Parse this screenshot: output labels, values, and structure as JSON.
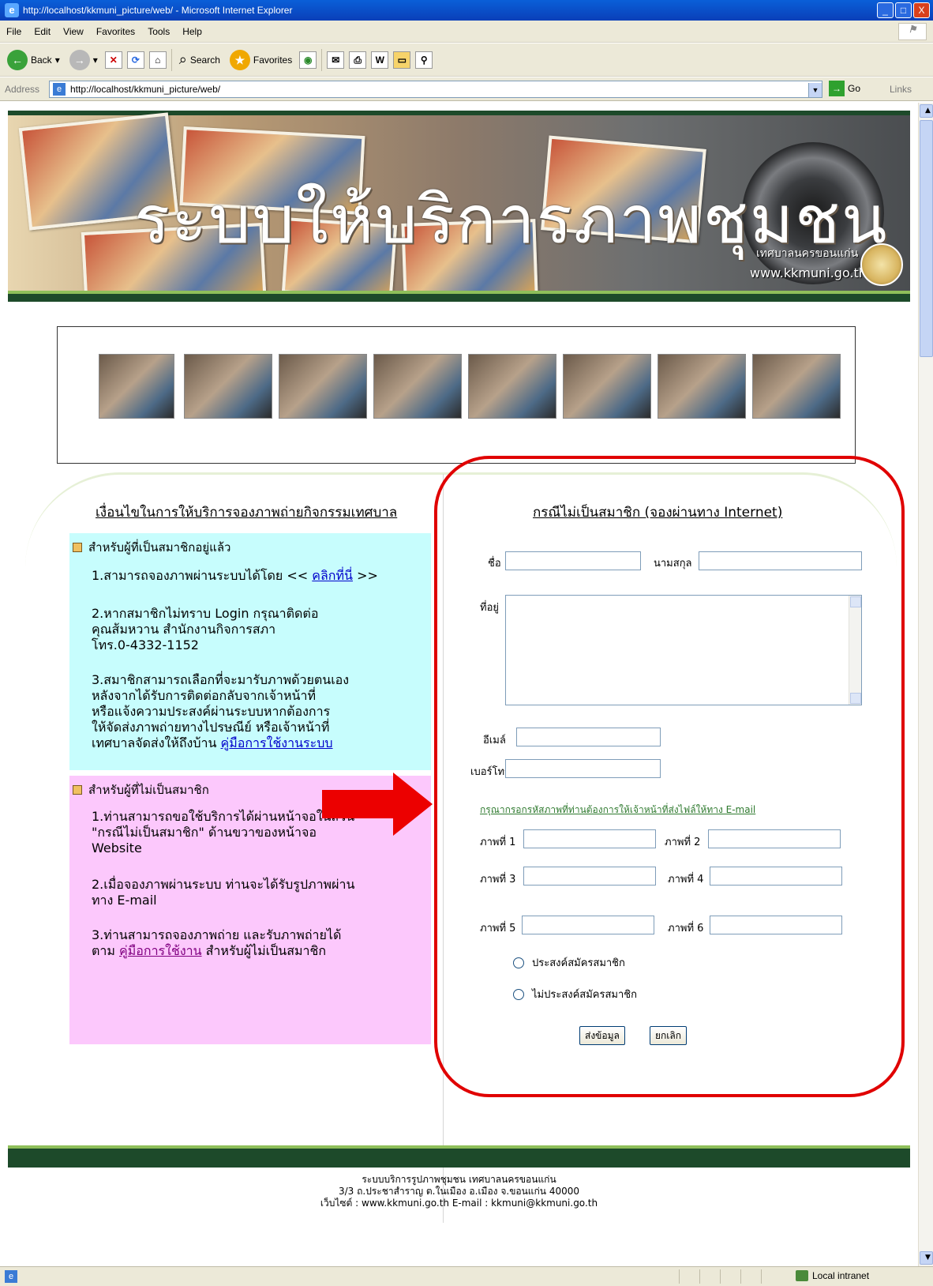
{
  "window": {
    "title": "http://localhost/kkmuni_picture/web/ - Microsoft Internet Explorer",
    "controls": [
      "_",
      "□",
      "X"
    ]
  },
  "menu": [
    "File",
    "Edit",
    "View",
    "Favorites",
    "Tools",
    "Help"
  ],
  "toolbar": {
    "back": "Back",
    "search": "Search",
    "favorites": "Favorites"
  },
  "address": {
    "label": "Address",
    "url": "http://localhost/kkmuni_picture/web/",
    "go": "Go",
    "links": "Links"
  },
  "banner": {
    "title": "ระบบให้บริการภาพชุมชน",
    "org": "เทศบาลนครขอนแก่น",
    "website": "www.kkmuni.go.th"
  },
  "left": {
    "title": "เงื่อนไขในการให้บริการจองภาพถ่ายกิจกรรมเทศบาล",
    "member": {
      "heading": "สำหรับผู้ที่เป็นสมาชิกอยู่แล้ว",
      "item1_pre": "1.สามารถจองภาพผ่านระบบได้โดย <<",
      "item1_link": "คลิกที่นี่",
      "item1_post": ">>",
      "item2": "2.หากสมาชิกไม่ทราบ Login กรุณาติดต่อ\n   คุณส้มหวาน สำนักงานกิจการสภา\n   โทร.0-4332-1152",
      "item3": "3.สมาชิกสามารถเลือกที่จะมารับภาพด้วยตนเอง\n   หลังจากได้รับการติดต่อกลับจากเจ้าหน้าที่\n   หรือแจ้งความประสงค์ผ่านระบบหากต้องการ\n   ให้จัดส่งภาพถ่ายทางไปรษณีย์ หรือเจ้าหน้าที่\n   เทศบาลจัดส่งให้ถึงบ้าน",
      "item3_link": "คู่มือการใช้งานระบบ"
    },
    "nonmember": {
      "heading": "สำหรับผู้ที่ไม่เป็นสมาชิก",
      "item1": "1.ท่านสามารถขอใช้บริการได้ผ่านหน้าจอในส่วน\n   \"กรณีไม่เป็นสมาชิก\" ด้านขวาของหน้าจอ\n   Website",
      "item2": "2.เมื่อจองภาพผ่านระบบ ท่านจะได้รับรูปภาพผ่าน\n   ทาง E-mail",
      "item3_pre": "3.ท่านสามารถจองภาพถ่าย และรับภาพถ่ายได้\n  ตาม",
      "item3_link": "คู่มือการใช้งาน",
      "item3_post": "สำหรับผู้ไม่เป็นสมาชิก"
    }
  },
  "form": {
    "title": "กรณีไม่เป็นสมาชิก (จองผ่านทาง Internet)",
    "first_name": "ชื่อ",
    "last_name": "นามสกุล",
    "address": "ที่อยู่",
    "email": "อีเมล์",
    "phone": "เบอร์โทร",
    "photo_note": "กรุณากรอกรหัสภาพที่ท่านต้องการให้เจ้าหน้าที่ส่งไฟล์ให้ทาง E-mail",
    "photo1": "ภาพที่ 1",
    "photo2": "ภาพที่ 2",
    "photo3": "ภาพที่ 3",
    "photo4": "ภาพที่ 4",
    "photo5": "ภาพที่ 5",
    "photo6": "ภาพที่ 6",
    "radio_yes": "ประสงค์สมัครสมาชิก",
    "radio_no": "ไม่ประสงค์สมัครสมาชิก",
    "submit": "ส่งข้อมูล",
    "cancel": "ยกเลิก"
  },
  "footer": {
    "line1": "ระบบบริการรูปภาพชุมชน เทศบาลนครขอนแก่น",
    "line2": "3/3 ถ.ประชาสำราญ ต.ในเมือง อ.เมือง จ.ขอนแก่น 40000",
    "line3": "เว็บไซต์ : www.kkmuni.go.th E-mail : kkmuni@kkmuni.go.th"
  },
  "status": {
    "zone": "Local intranet"
  },
  "colors": {
    "highlight_oval": "#e00000",
    "member_box": "#c7fdfd",
    "nonmember_box": "#fcc8fc",
    "band": "#1d4a2a"
  }
}
